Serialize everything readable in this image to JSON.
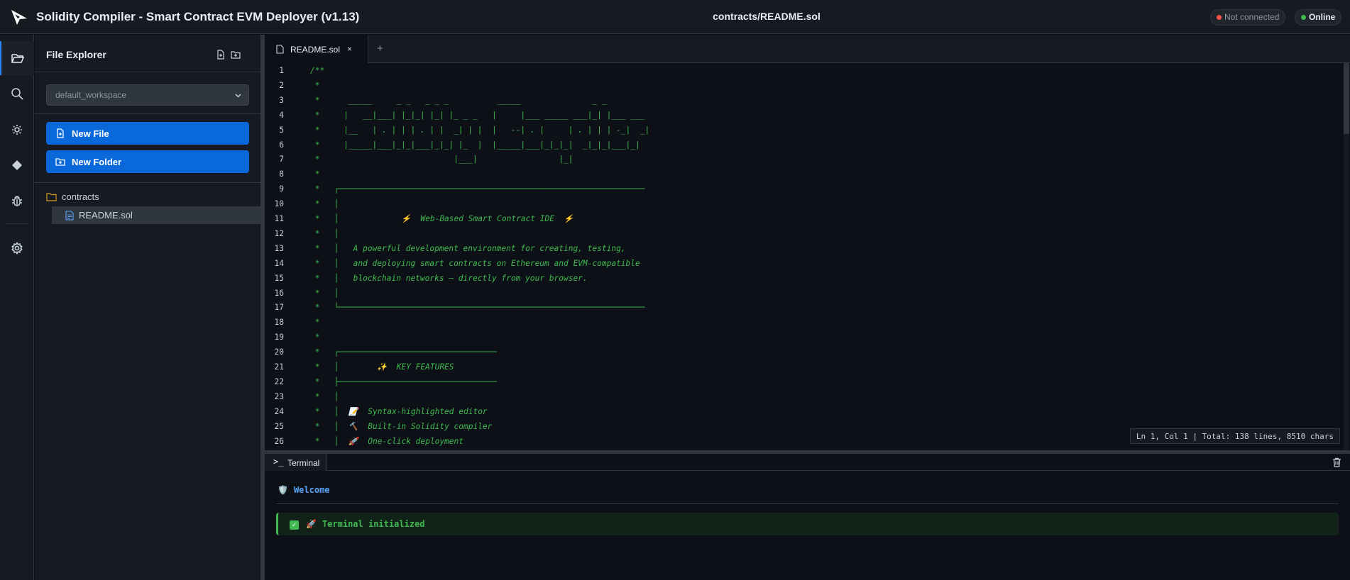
{
  "app": {
    "title": "Solidity Compiler - Smart Contract EVM Deployer (v1.13)",
    "current_path": "contracts/README.sol",
    "status_wallet": "Not connected",
    "status_network": "Online"
  },
  "activity_bar": [
    "file-explorer",
    "search",
    "compile",
    "deploy",
    "debug",
    "settings"
  ],
  "sidebar": {
    "title": "File Explorer",
    "workspace": "default_workspace",
    "new_file_label": "New File",
    "new_folder_label": "New Folder",
    "tree": {
      "folder": "contracts",
      "file": "README.sol"
    }
  },
  "editor": {
    "tab_label": "README.sol",
    "tab_close": "×",
    "add_tab": "+",
    "status": "Ln 1, Col 1 | Total: 138 lines, 8510 chars",
    "lines": [
      {
        "n": "1",
        "t": "/**"
      },
      {
        "n": "2",
        "t": " *"
      },
      {
        "n": "3",
        "t": " *      _____     _ _   _ _ _          _____               _ _"
      },
      {
        "n": "4",
        "t": " *     |   __|___| |_|_| |_| |_ _ _   |     |___ _____ ___|_| |___ ___"
      },
      {
        "n": "5",
        "t": " *     |__   | . | | | . | |  _| | |  |   --| . |     | . | | | -_|  _|"
      },
      {
        "n": "6",
        "t": " *     |_____|___|_|_|___|_|_| |_  |  |_____|___|_|_|_|  _|_|_|___|_|"
      },
      {
        "n": "7",
        "t": " *                            |___|                 |_|"
      },
      {
        "n": "8",
        "t": " *"
      },
      {
        "n": "9",
        "t": " *   ┌────────────────────────────────────────────────────────────────"
      },
      {
        "n": "10",
        "t": " *   │"
      },
      {
        "n": "11",
        "t": " *   │             ⚡  Web-Based Smart Contract IDE  ⚡"
      },
      {
        "n": "12",
        "t": " *   │"
      },
      {
        "n": "13",
        "t": " *   │   A powerful development environment for creating, testing,"
      },
      {
        "n": "14",
        "t": " *   │   and deploying smart contracts on Ethereum and EVM-compatible"
      },
      {
        "n": "15",
        "t": " *   │   blockchain networks — directly from your browser."
      },
      {
        "n": "16",
        "t": " *   │"
      },
      {
        "n": "17",
        "t": " *   └────────────────────────────────────────────────────────────────"
      },
      {
        "n": "18",
        "t": " *"
      },
      {
        "n": "19",
        "t": " *"
      },
      {
        "n": "20",
        "t": " *   ┌─────────────────────────────────"
      },
      {
        "n": "21",
        "t": " *   │        ✨  KEY FEATURES"
      },
      {
        "n": "22",
        "t": " *   ├─────────────────────────────────"
      },
      {
        "n": "23",
        "t": " *   │"
      },
      {
        "n": "24",
        "t": " *   │  📝  Syntax-highlighted editor"
      },
      {
        "n": "25",
        "t": " *   │  🔨  Built-in Solidity compiler"
      },
      {
        "n": "26",
        "t": " *   │  🚀  One-click deployment"
      }
    ]
  },
  "terminal": {
    "tab_label": "Terminal",
    "prompt_glyph": ">_",
    "welcome": "Welcome",
    "welcome_icon": "🛡️",
    "message": "Terminal initialized",
    "message_check": "✓",
    "message_icon": "🚀"
  },
  "colors": {
    "accent": "#0969da",
    "comment": "#3fb950",
    "background": "#0d1117"
  }
}
